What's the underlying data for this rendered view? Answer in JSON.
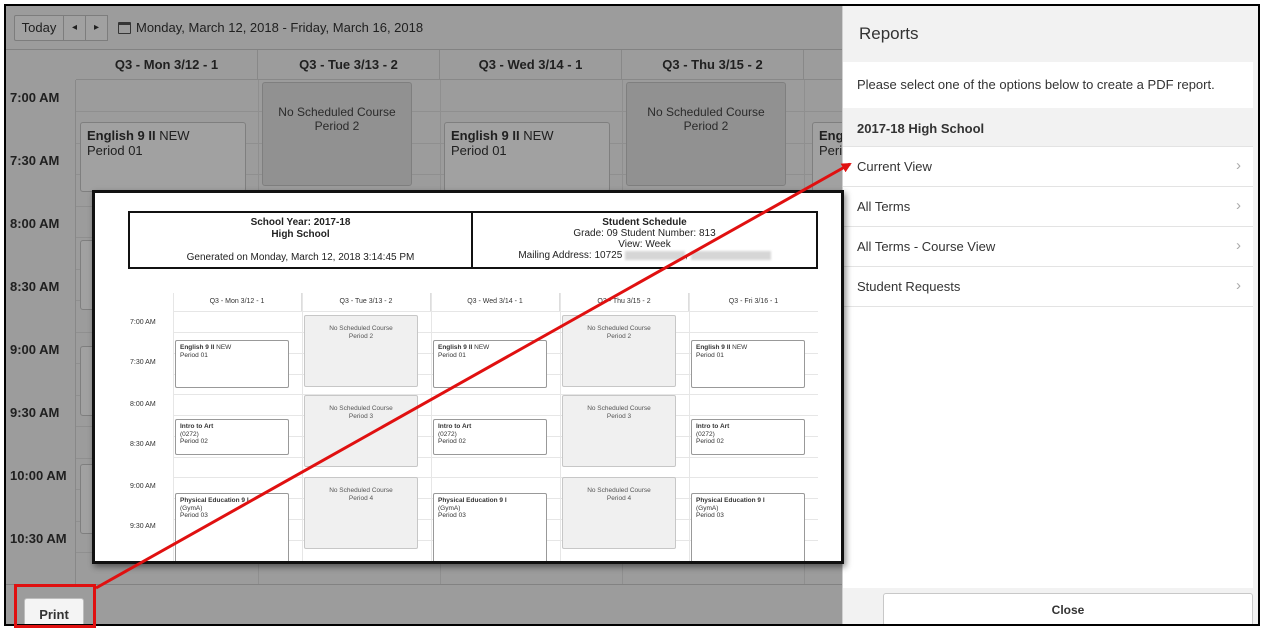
{
  "toolbar": {
    "today_label": "Today",
    "prev_icon": "◂",
    "next_icon": "▸",
    "date_range": "Monday, March 12, 2018 - Friday, March 16, 2018"
  },
  "calendar": {
    "days": [
      "Q3 - Mon 3/12 - 1",
      "Q3 - Tue 3/13 - 2",
      "Q3 - Wed 3/14 - 1",
      "Q3 - Thu 3/15 - 2"
    ],
    "times": [
      "7:00 AM",
      "7:30 AM",
      "8:00 AM",
      "8:30 AM",
      "9:00 AM",
      "9:30 AM",
      "10:00 AM",
      "10:30 AM"
    ],
    "courses": {
      "mon": {
        "name": "English 9 II",
        "tag": "NEW",
        "period": "Period 01"
      },
      "tue": {
        "title": "No Scheduled Course",
        "period": "Period 2"
      },
      "wed": {
        "name": "English 9 II",
        "tag": "NEW",
        "period": "Period 01"
      },
      "thu": {
        "title": "No Scheduled Course",
        "period": "Period 2"
      },
      "fri_partial_name": "Engli",
      "fri_partial_period": "Peric"
    },
    "print_label": "Print"
  },
  "reports": {
    "title": "Reports",
    "description": "Please select one of the options below to create a PDF report.",
    "section": "2017-18 High School",
    "items": [
      {
        "label": "Current View"
      },
      {
        "label": "All Terms"
      },
      {
        "label": "All Terms - Course View"
      },
      {
        "label": "Student Requests"
      }
    ],
    "chevron": "›",
    "close_label": "Close"
  },
  "pdf": {
    "school_year": "School Year: 2017-18",
    "school": "High School",
    "generated": "Generated on Monday, March 12, 2018 3:14:45 PM",
    "doc_title": "Student Schedule",
    "grade_line": "Grade: 09 Student Number: 813",
    "view_line": "View: Week",
    "address_prefix": "Mailing Address: 10725",
    "address_comma": ",",
    "days": [
      "Q3 - Mon 3/12 - 1",
      "Q3 - Tue 3/13 - 2",
      "Q3 - Wed 3/14 - 1",
      "Q3 - Thu 3/15 - 2",
      "Q3 - Fri 3/16 - 1"
    ],
    "times": [
      "7:00 AM",
      "7:30 AM",
      "8:00 AM",
      "8:30 AM",
      "9:00 AM",
      "9:30 AM"
    ],
    "english": {
      "name": "English 9 II",
      "tag": "NEW",
      "period": "Period 01"
    },
    "art": {
      "name": "Intro to Art",
      "code": "(0272)",
      "period": "Period 02"
    },
    "pe": {
      "name": "Physical Education 9 I",
      "room": "(GymA)",
      "period": "Period 03"
    },
    "none": "No Scheduled Course",
    "none_periods": [
      "Period 2",
      "Period 3",
      "Period 4"
    ]
  },
  "colors": {
    "annotation": "#e01010"
  }
}
